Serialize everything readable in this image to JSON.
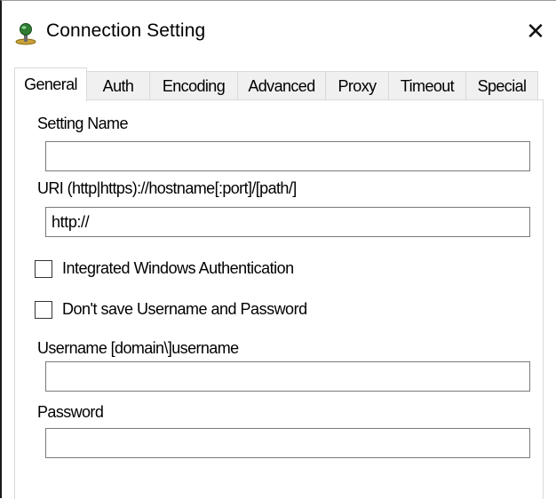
{
  "window": {
    "title": "Connection Setting",
    "icon": "network-connection-icon",
    "close_glyph": "✕"
  },
  "tabs": [
    {
      "label": "General",
      "active": true
    },
    {
      "label": "Auth",
      "active": false
    },
    {
      "label": "Encoding",
      "active": false
    },
    {
      "label": "Advanced",
      "active": false
    },
    {
      "label": "Proxy",
      "active": false
    },
    {
      "label": "Timeout",
      "active": false
    },
    {
      "label": "Special",
      "active": false
    }
  ],
  "form": {
    "setting_name_label": "Setting Name",
    "setting_name_value": "",
    "uri_label": "URI  (http|https)://hostname[:port]/[path/]",
    "uri_value": "http://",
    "integrated_auth_label": "Integrated Windows Authentication",
    "integrated_auth_checked": false,
    "dont_save_label": "Don't save Username and Password",
    "dont_save_checked": false,
    "username_label": "Username  [domain\\]username",
    "username_value": "",
    "password_label": "Password",
    "password_value": ""
  }
}
